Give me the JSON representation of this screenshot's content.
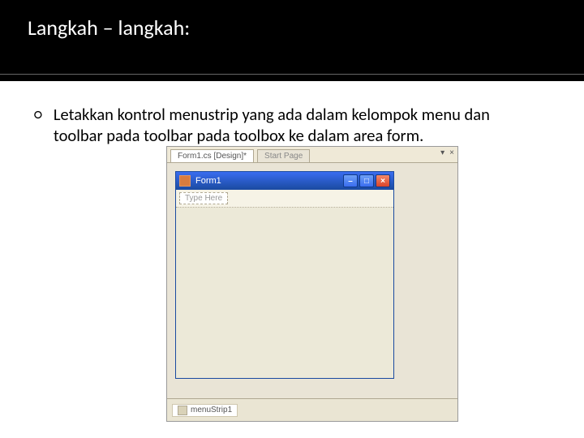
{
  "slide": {
    "title": "Langkah – langkah:",
    "bullet_text": "Letakkan kontrol menustrip yang ada dalam kelompok menu dan toolbar pada toolbar pada toolbox ke dalam area form."
  },
  "vs": {
    "tab_active": "Form1.cs [Design]*",
    "tab_inactive": "Start Page",
    "tab_dropdown_glyph": "▾",
    "tab_close_glyph": "×",
    "form_title": "Form1",
    "min_glyph": "–",
    "max_glyph": "□",
    "close_glyph": "×",
    "menustrip_placeholder": "Type Here",
    "tray_item": "menuStrip1"
  }
}
